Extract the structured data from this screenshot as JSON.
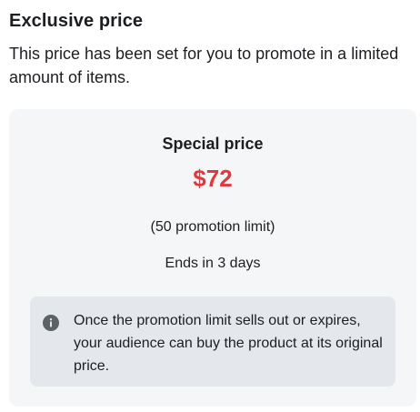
{
  "header": {
    "title": "Exclusive price",
    "subtitle": "This price has been set for you to promote in a limited amount of items."
  },
  "offer_card": {
    "label": "Special price",
    "price": "$72",
    "limit": "(50 promotion limit)",
    "ends": "Ends in 3 days",
    "notice": {
      "icon": "info-icon",
      "text": "Once the promotion limit sells out or expires, your audience can buy the product at its original price."
    }
  },
  "colors": {
    "price": "#e0383e",
    "card_background": "#f5f6f7",
    "notice_background": "#e4e8ec",
    "icon": "#5c6166"
  }
}
